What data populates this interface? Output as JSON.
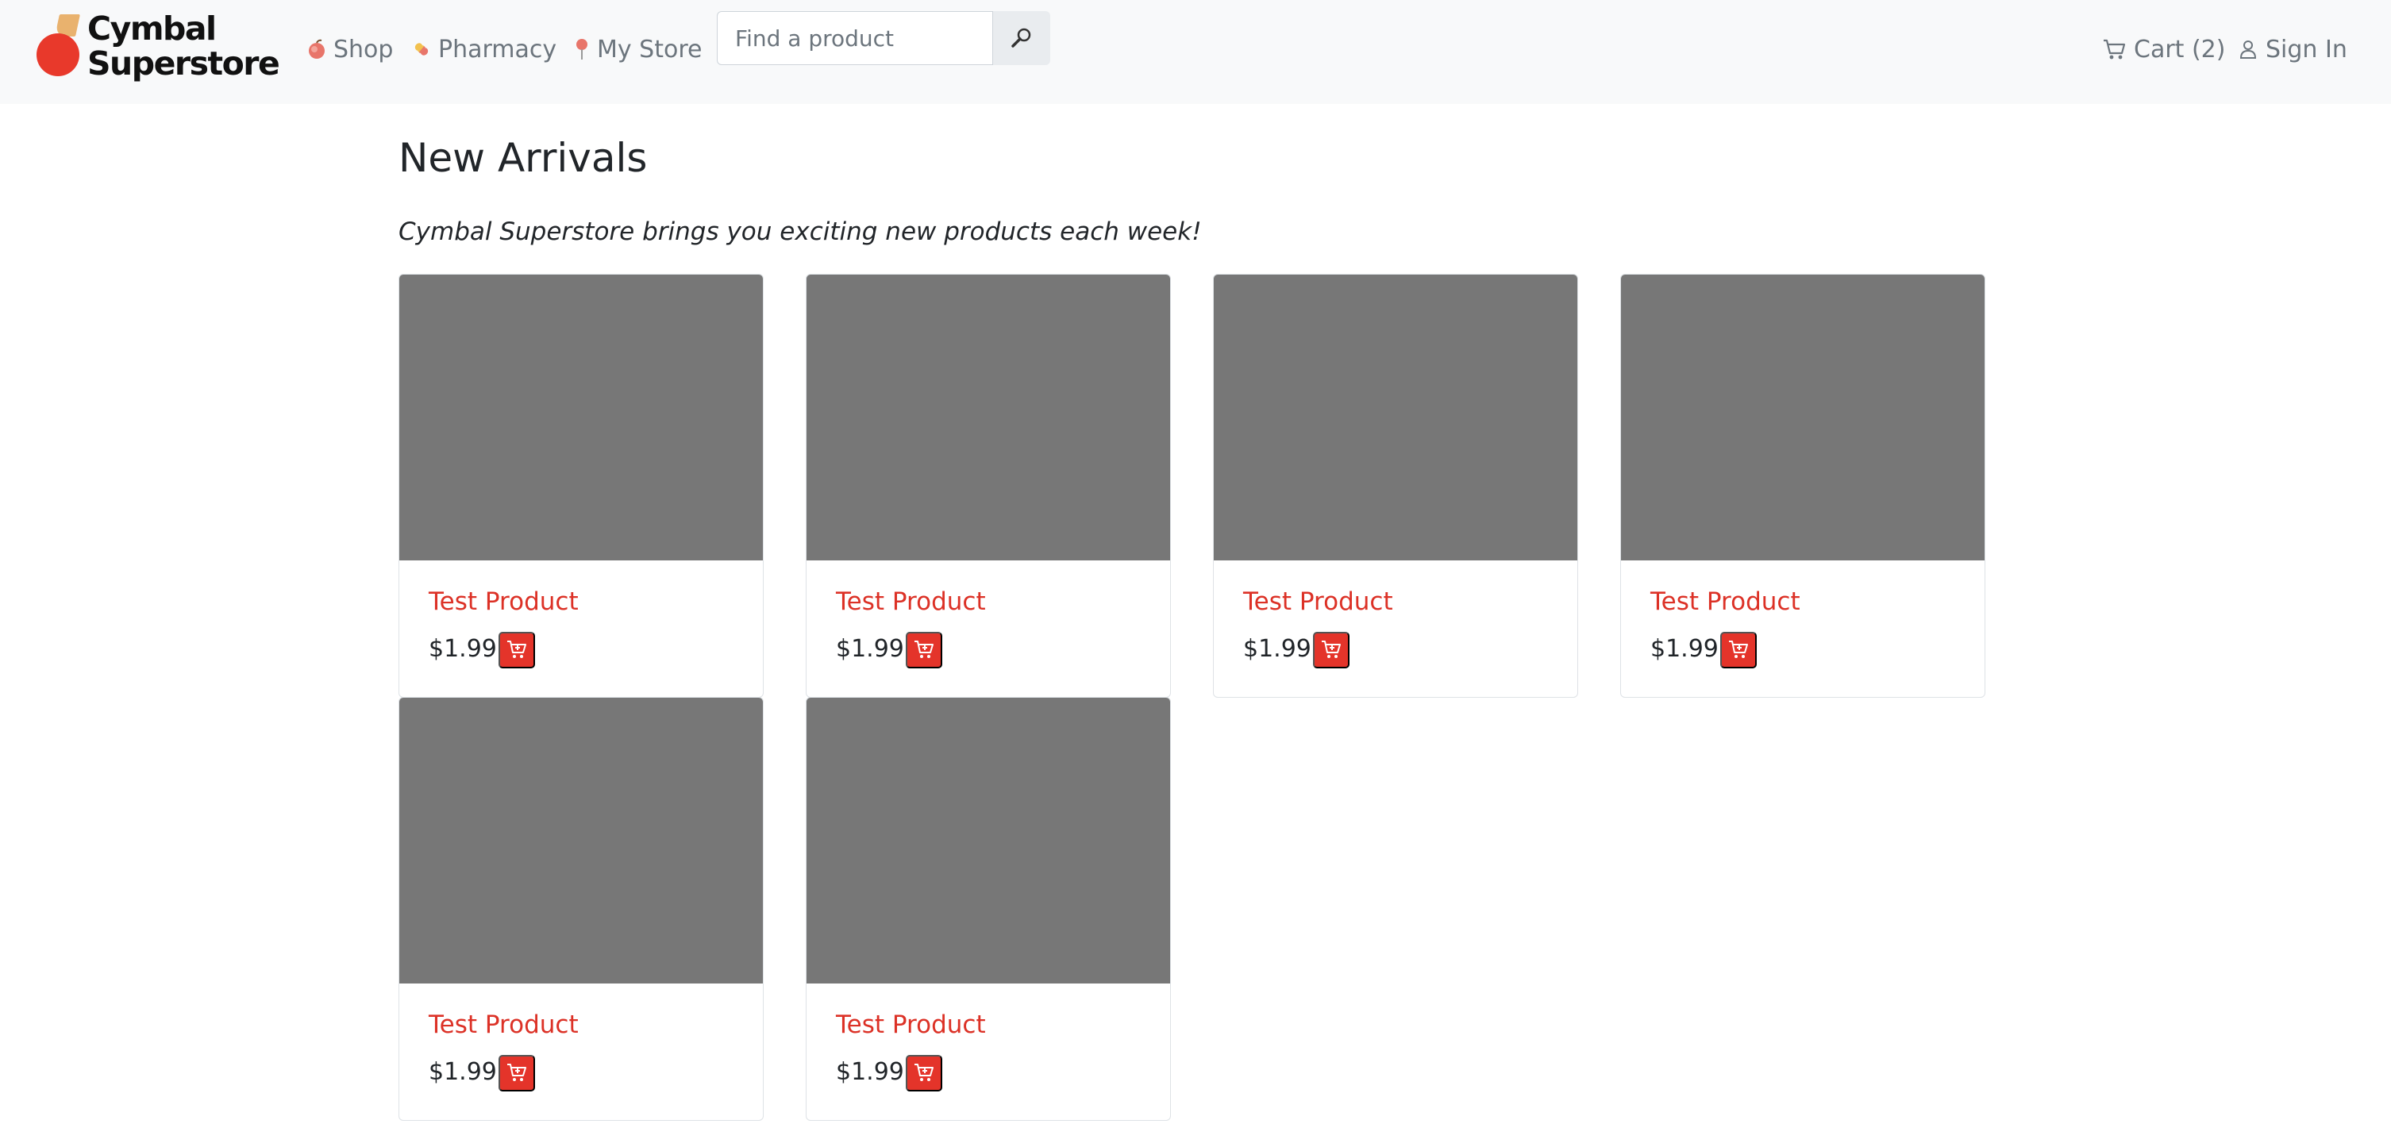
{
  "brand": {
    "line1": "Cymbal",
    "line2": "Superstore",
    "colors": {
      "red": "#e8392b",
      "gold": "#e9b26e"
    }
  },
  "nav": {
    "shop": {
      "label": "Shop",
      "icon": "apple-icon"
    },
    "pharmacy": {
      "label": "Pharmacy",
      "icon": "pill-icon"
    },
    "store": {
      "label": "My Store",
      "icon": "pin-icon"
    },
    "search": {
      "placeholder": "Find a product",
      "value": "",
      "button_icon": "magnifier-icon"
    },
    "cart": {
      "label": "Cart (2)",
      "icon": "cart-icon"
    },
    "signin": {
      "label": "Sign In",
      "icon": "person-icon"
    }
  },
  "main": {
    "title": "New Arrivals",
    "subtitle": "Cymbal Superstore brings you exciting new products each week!",
    "accent_color": "#dc3126",
    "products": [
      {
        "name": "Test Product",
        "price": "$1.99"
      },
      {
        "name": "Test Product",
        "price": "$1.99"
      },
      {
        "name": "Test Product",
        "price": "$1.99"
      },
      {
        "name": "Test Product",
        "price": "$1.99"
      },
      {
        "name": "Test Product",
        "price": "$1.99"
      },
      {
        "name": "Test Product",
        "price": "$1.99"
      }
    ]
  }
}
